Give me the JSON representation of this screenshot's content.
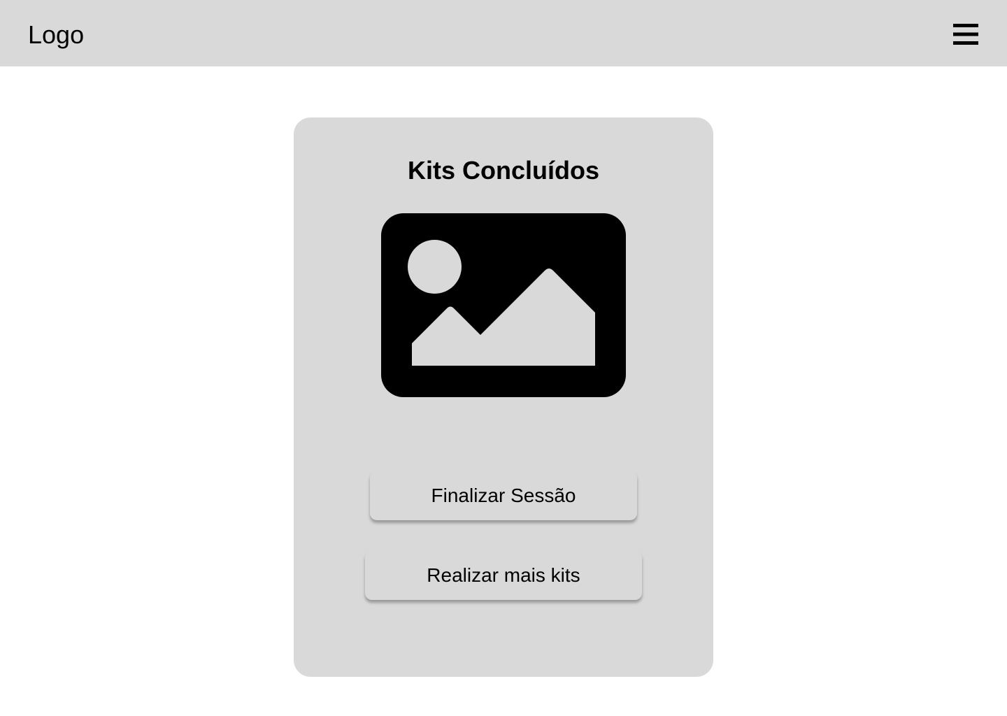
{
  "header": {
    "logo_text": "Logo",
    "menu_icon": "hamburger-menu-icon",
    "background_color": "#d9d9d9"
  },
  "card": {
    "title": "Kits Concluídos",
    "image_icon": "image-placeholder-icon",
    "background_color": "#d9d9d9",
    "buttons": {
      "finalize_label": "Finalizar Sessão",
      "more_kits_label": "Realizar mais kits"
    }
  }
}
